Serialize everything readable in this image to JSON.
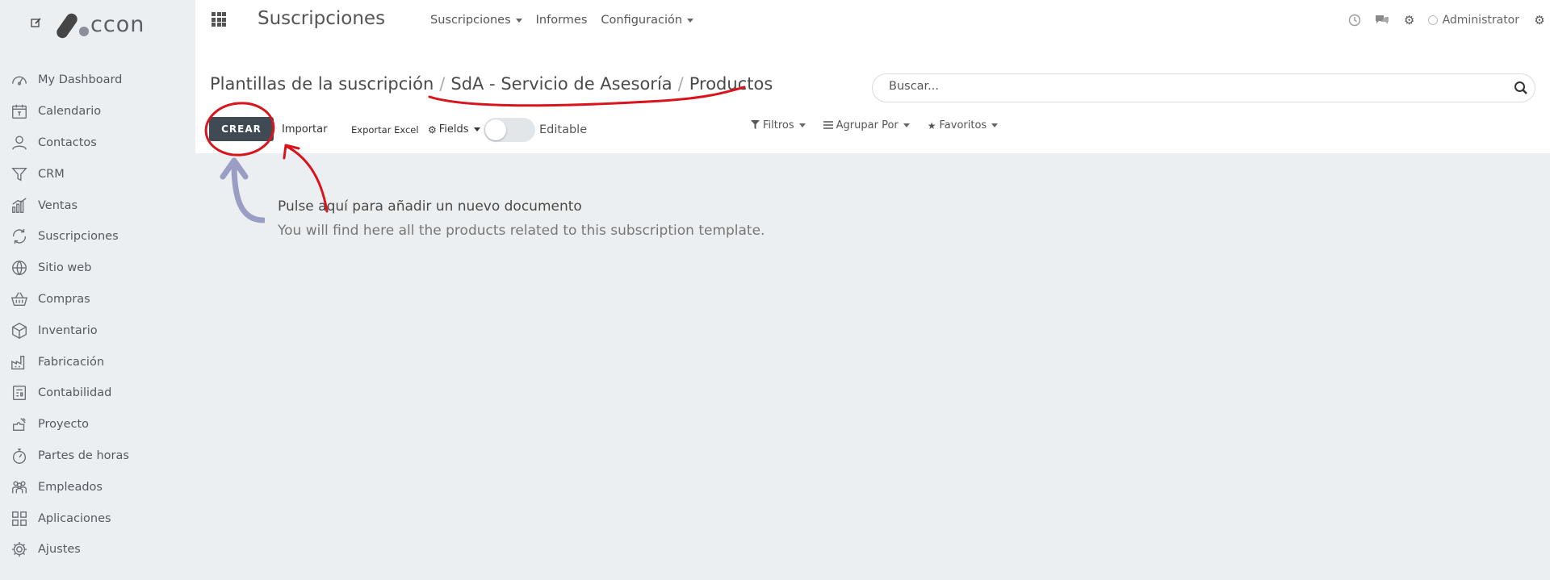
{
  "sidebar": {
    "logo_text": "ccon",
    "items": [
      {
        "label": "My Dashboard",
        "icon": "dashboard-icon"
      },
      {
        "label": "Calendario",
        "icon": "calendar-icon"
      },
      {
        "label": "Contactos",
        "icon": "user-icon"
      },
      {
        "label": "CRM",
        "icon": "funnel-icon"
      },
      {
        "label": "Ventas",
        "icon": "bar-chart-icon"
      },
      {
        "label": "Suscripciones",
        "icon": "refresh-icon"
      },
      {
        "label": "Sitio web",
        "icon": "globe-icon"
      },
      {
        "label": "Compras",
        "icon": "basket-icon"
      },
      {
        "label": "Inventario",
        "icon": "box-icon"
      },
      {
        "label": "Fabricación",
        "icon": "factory-icon"
      },
      {
        "label": "Contabilidad",
        "icon": "ledger-icon"
      },
      {
        "label": "Proyecto",
        "icon": "puzzle-icon"
      },
      {
        "label": "Partes de horas",
        "icon": "stopwatch-icon"
      },
      {
        "label": "Empleados",
        "icon": "employees-icon"
      },
      {
        "label": "Aplicaciones",
        "icon": "apps-grid-icon"
      },
      {
        "label": "Ajustes",
        "icon": "gear-icon"
      }
    ]
  },
  "topbar": {
    "app_title": "Suscripciones",
    "menu": [
      {
        "label": "Suscripciones",
        "dropdown": true
      },
      {
        "label": "Informes",
        "dropdown": false
      },
      {
        "label": "Configuración",
        "dropdown": true
      }
    ],
    "user": "Administrator"
  },
  "breadcrumb": {
    "items": [
      "Plantillas de la suscripción",
      "SdA - Servicio de Asesoría",
      "Productos"
    ],
    "separator": "/"
  },
  "search": {
    "placeholder": "Buscar..."
  },
  "toolbar": {
    "create_label": "CREAR",
    "import_label": "Importar",
    "export_label": "Exportar Excel",
    "fields_label": "Fields",
    "editable_label": "Editable",
    "editable_on": false
  },
  "filters": {
    "filters_label": "Filtros",
    "group_label": "Agrupar Por",
    "favorites_label": "Favoritos"
  },
  "help": {
    "title": "Pulse aquí para añadir un nuevo documento",
    "text": "You will find here all the products related to this subscription template."
  },
  "colors": {
    "primary_button": "#3f4a54",
    "sidebar_bg": "#eceff2",
    "annotation_red": "#d9141c"
  }
}
